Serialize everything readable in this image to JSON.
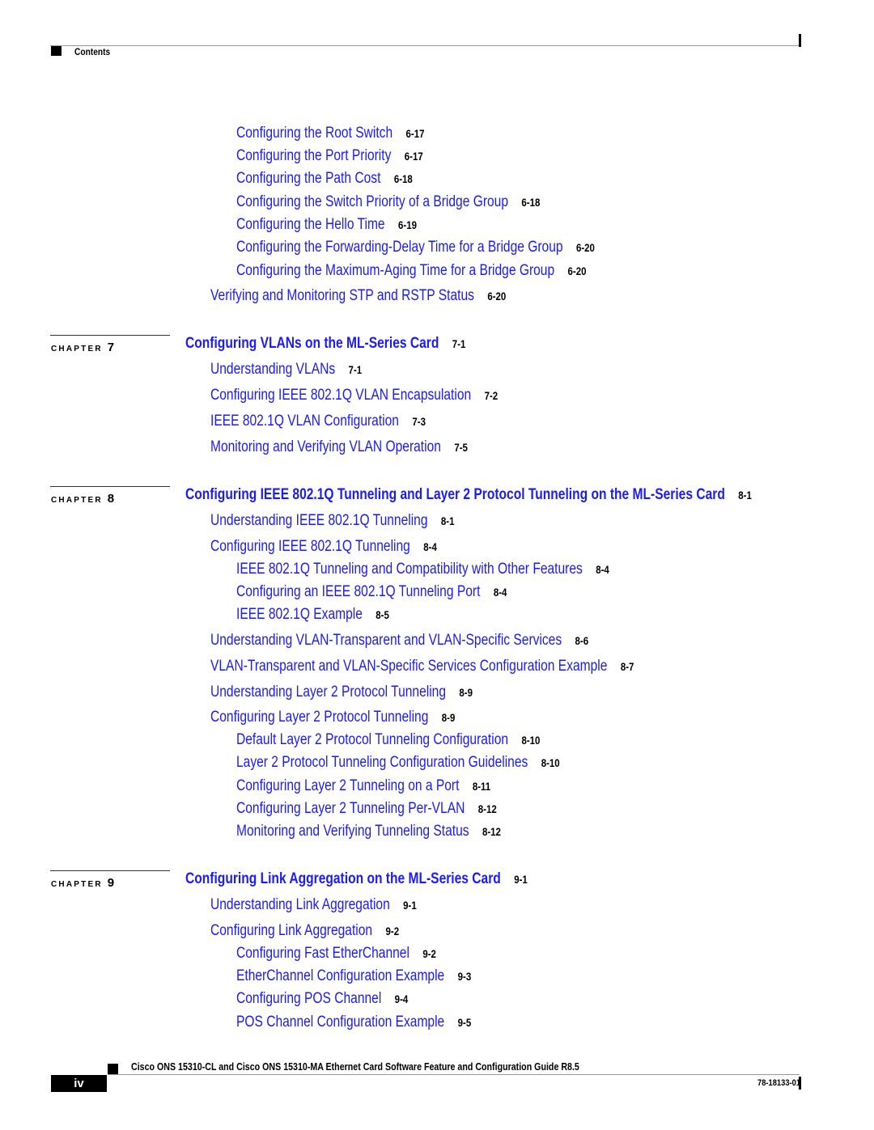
{
  "header": {
    "section_title": "Contents"
  },
  "toc": {
    "ch6_tail": [
      {
        "title": "Configuring the Root Switch",
        "page": "6-17",
        "level": 2
      },
      {
        "title": "Configuring the Port Priority",
        "page": "6-17",
        "level": 2
      },
      {
        "title": "Configuring the Path Cost",
        "page": "6-18",
        "level": 2
      },
      {
        "title": "Configuring the Switch Priority of a Bridge Group",
        "page": "6-18",
        "level": 2
      },
      {
        "title": "Configuring the Hello Time",
        "page": "6-19",
        "level": 2
      },
      {
        "title": "Configuring the Forwarding-Delay Time for a Bridge Group",
        "page": "6-20",
        "level": 2
      },
      {
        "title": "Configuring the Maximum-Aging Time for a Bridge Group",
        "page": "6-20",
        "level": 2
      },
      {
        "title": "Verifying and Monitoring STP and RSTP Status",
        "page": "6-20",
        "level": 1
      }
    ],
    "chapters": [
      {
        "label": "CHAPTER",
        "number": "7",
        "title": "Configuring VLANs on the ML-Series Card",
        "page": "7-1",
        "entries": [
          {
            "title": "Understanding VLANs",
            "page": "7-1",
            "level": 1
          },
          {
            "title": "Configuring IEEE 802.1Q VLAN Encapsulation",
            "page": "7-2",
            "level": 1
          },
          {
            "title": "IEEE 802.1Q VLAN Configuration",
            "page": "7-3",
            "level": 1
          },
          {
            "title": "Monitoring and Verifying VLAN Operation",
            "page": "7-5",
            "level": 1
          }
        ]
      },
      {
        "label": "CHAPTER",
        "number": "8",
        "title": "Configuring IEEE 802.1Q Tunneling and Layer 2 Protocol Tunneling on the ML-Series Card",
        "page": "8-1",
        "entries": [
          {
            "title": "Understanding IEEE 802.1Q Tunneling",
            "page": "8-1",
            "level": 1
          },
          {
            "title": "Configuring IEEE 802.1Q Tunneling",
            "page": "8-4",
            "level": 1
          },
          {
            "title": "IEEE 802.1Q Tunneling and Compatibility with Other Features",
            "page": "8-4",
            "level": 2
          },
          {
            "title": "Configuring an IEEE 802.1Q Tunneling Port",
            "page": "8-4",
            "level": 2
          },
          {
            "title": "IEEE 802.1Q Example",
            "page": "8-5",
            "level": 2
          },
          {
            "title": "Understanding VLAN-Transparent and VLAN-Specific Services",
            "page": "8-6",
            "level": 1
          },
          {
            "title": "VLAN-Transparent and VLAN-Specific Services Configuration Example",
            "page": "8-7",
            "level": 1
          },
          {
            "title": "Understanding Layer 2 Protocol Tunneling",
            "page": "8-9",
            "level": 1
          },
          {
            "title": "Configuring Layer 2 Protocol Tunneling",
            "page": "8-9",
            "level": 1
          },
          {
            "title": "Default Layer 2 Protocol Tunneling Configuration",
            "page": "8-10",
            "level": 2
          },
          {
            "title": "Layer 2 Protocol Tunneling Configuration Guidelines",
            "page": "8-10",
            "level": 2
          },
          {
            "title": "Configuring Layer 2 Tunneling on a Port",
            "page": "8-11",
            "level": 2
          },
          {
            "title": "Configuring Layer 2 Tunneling Per-VLAN",
            "page": "8-12",
            "level": 2
          },
          {
            "title": "Monitoring and Verifying Tunneling Status",
            "page": "8-12",
            "level": 2
          }
        ]
      },
      {
        "label": "CHAPTER",
        "number": "9",
        "title": "Configuring Link Aggregation on the ML-Series Card",
        "page": "9-1",
        "entries": [
          {
            "title": "Understanding Link Aggregation",
            "page": "9-1",
            "level": 1
          },
          {
            "title": "Configuring Link Aggregation",
            "page": "9-2",
            "level": 1
          },
          {
            "title": "Configuring Fast EtherChannel",
            "page": "9-2",
            "level": 2
          },
          {
            "title": "EtherChannel Configuration Example",
            "page": "9-3",
            "level": 2
          },
          {
            "title": "Configuring POS Channel",
            "page": "9-4",
            "level": 2
          },
          {
            "title": "POS Channel Configuration Example",
            "page": "9-5",
            "level": 2
          }
        ]
      }
    ]
  },
  "footer": {
    "guide_title": "Cisco ONS 15310-CL and Cisco ONS 15310-MA Ethernet Card Software Feature and Configuration Guide R8.5",
    "page_number": "iv",
    "doc_number": "78-18133-01"
  },
  "colors": {
    "link": "#1a1aff",
    "text": "#000000",
    "rule": "#999999"
  }
}
